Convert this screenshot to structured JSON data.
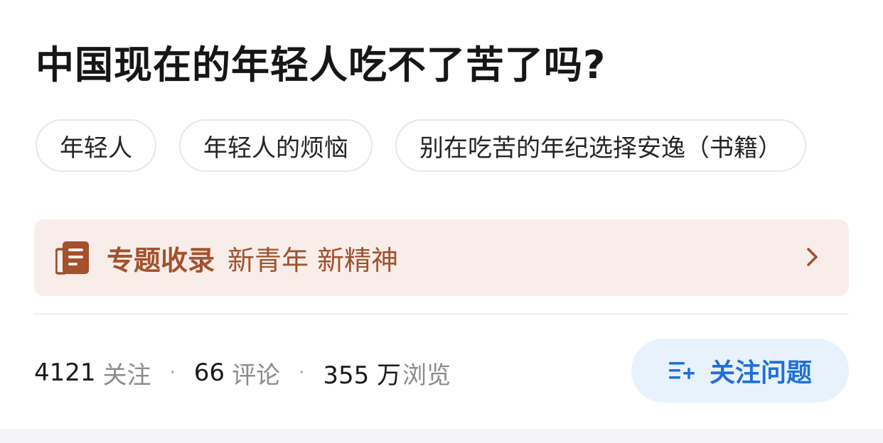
{
  "question": {
    "title": "中国现在的年轻人吃不了苦了吗?"
  },
  "tags": [
    {
      "label": "年轻人"
    },
    {
      "label": "年轻人的烦恼"
    },
    {
      "label": "别在吃苦的年纪选择安逸（书籍）"
    }
  ],
  "topic": {
    "prefix": "专题收录",
    "name": "新青年 新精神",
    "icon": "document-collection-icon",
    "color": "#a2512e",
    "background": "#f8ede8"
  },
  "stats": {
    "followers": {
      "value": "4121",
      "unit": "关注"
    },
    "comments": {
      "value": "66",
      "unit": "评论"
    },
    "views": {
      "value": "355 万",
      "unit": "浏览"
    },
    "separator": "·"
  },
  "follow_button": {
    "label": "关注问题",
    "icon": "add-list-icon",
    "color": "#1f6fdc",
    "background": "#e8f2fc"
  }
}
